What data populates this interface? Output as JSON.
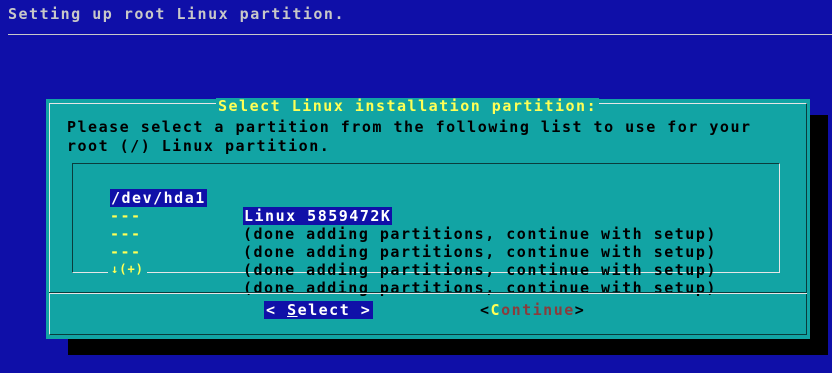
{
  "backtitle": "Setting up root Linux partition.",
  "dialog": {
    "title": "Select Linux installation partition:",
    "prompt_line1": "Please select a partition from the following list to use for your",
    "prompt_line2": "root (/) Linux partition.",
    "items": [
      {
        "tag": "/dev/hda1",
        "desc": "Linux 5859472K",
        "selected": true
      },
      {
        "tag": "---",
        "desc": "(done adding partitions, continue with setup)",
        "selected": false
      },
      {
        "tag": "---",
        "desc": "(done adding partitions, continue with setup)",
        "selected": false
      },
      {
        "tag": "---",
        "desc": "(done adding partitions, continue with setup)",
        "selected": false
      },
      {
        "tag": "---",
        "desc": "(done adding partitions, continue with setup)",
        "selected": false
      }
    ],
    "scroll_indicator": "↓(+)",
    "buttons": {
      "select": {
        "left": "< ",
        "hotkey": "S",
        "rest": "elect",
        "right": " >"
      },
      "continue": {
        "left": "<",
        "hotkey": "C",
        "rest": "ontinue",
        "right": ">"
      }
    }
  },
  "colors": {
    "screen_bg": "#0f0fa8",
    "dialog_bg": "#12a4a4",
    "title": "#ffff55",
    "highlight_bg": "#1010a8"
  }
}
